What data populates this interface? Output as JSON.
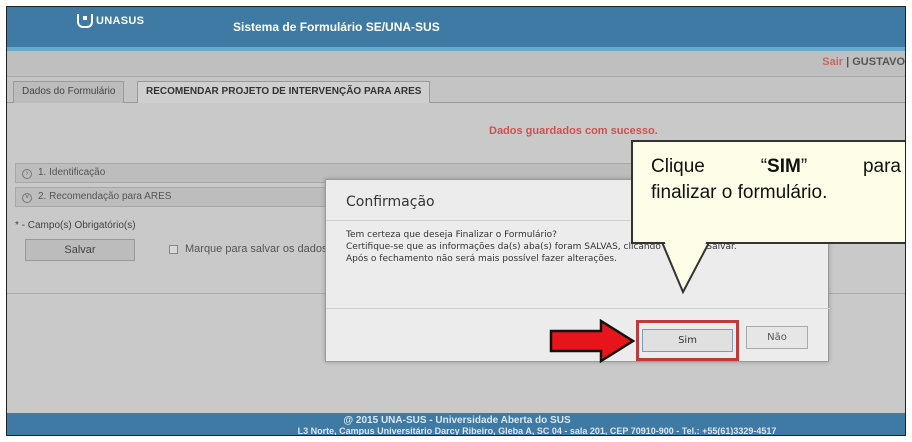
{
  "header": {
    "logo_text": "UNASUS",
    "system_title": "Sistema de Formulário SE/UNA-SUS"
  },
  "user_bar": {
    "logout": "Sair",
    "separator": " | ",
    "user": "GUSTAVO"
  },
  "tabs": [
    {
      "label": "Dados do Formulário"
    },
    {
      "label": "RECOMENDAR PROJETO DE INTERVENÇÃO PARA ARES"
    }
  ],
  "main": {
    "success_message": "Dados guardados com sucesso.",
    "sections": [
      {
        "toggle": "›",
        "label": "1. Identificação"
      },
      {
        "toggle": "˅",
        "label": "2. Recomendação para ARES"
      }
    ],
    "required_note": "* - Campo(s) Obrigatório(s)",
    "save_label": "Salvar",
    "checkbox_label": "Marque para salvar os dados"
  },
  "dialog": {
    "title": "Confirmação",
    "lines": [
      "Tem certeza que deseja Finalizar o Formulário?",
      "Certifique-se que as informações da(s) aba(s) foram SALVAS, clicando no botão Salvar.",
      "Após o fechamento não será mais possível fazer alterações."
    ],
    "confirm_label": "Sim",
    "cancel_label": "Não"
  },
  "callout": {
    "word1": "Clique",
    "quote_open": "“",
    "emphasis": "SIM",
    "quote_close": "”",
    "word2": "para",
    "line2": "finalizar o formulário."
  },
  "footer": {
    "line1": "@ 2015 UNA-SUS - Universidade Aberta do SUS",
    "line2": "L3 Norte, Campus Universitário Darcy Ribeiro, Gleba A, SC 04 - sala 201, CEP 70910-900 - Tel.: +55(61)3329-4517"
  },
  "colors": {
    "header_blue": "#3e7aa3",
    "highlight_red": "#c0393b",
    "arrow_red": "#e8141b",
    "success_red": "#d05050",
    "callout_bg": "#fefee8"
  },
  "icons": {
    "logo": "unasus-logo-icon",
    "arrow": "right-arrow-icon"
  }
}
